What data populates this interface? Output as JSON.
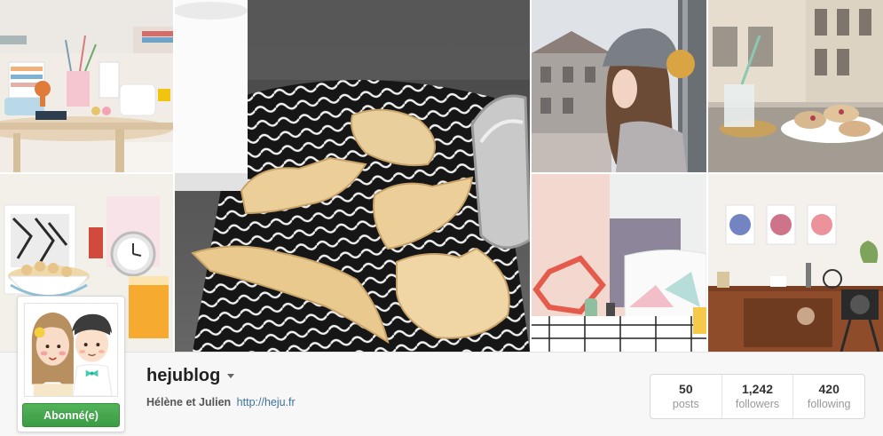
{
  "profile": {
    "username": "hejublog",
    "full_name": "Hélène et Julien",
    "website": "http://heju.fr",
    "follow_button": "Abonné(e)"
  },
  "stats": [
    {
      "value": "50",
      "label": "posts"
    },
    {
      "value": "1,242",
      "label": "followers"
    },
    {
      "value": "420",
      "label": "following"
    }
  ],
  "colors": {
    "follow_green": "#45a84e",
    "link_blue": "#3f729b",
    "bar_background": "#f7f7f7"
  },
  "photos": [
    {
      "name": "desk-photo"
    },
    {
      "name": "cookies-photo"
    },
    {
      "name": "woman-beanie-photo"
    },
    {
      "name": "balcony-snack-photo"
    },
    {
      "name": "breakfast-photo"
    },
    {
      "name": "pastel-interior-photo"
    },
    {
      "name": "posters-sideboard-photo"
    }
  ],
  "icons": {
    "dropdown": "caret-down-icon"
  }
}
